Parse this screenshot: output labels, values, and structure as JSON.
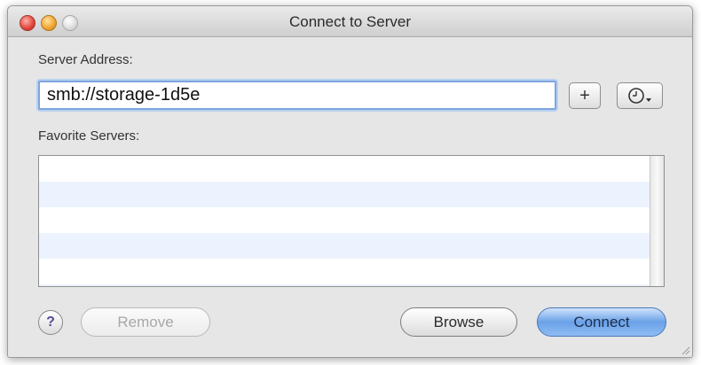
{
  "window": {
    "title": "Connect to Server"
  },
  "server_address": {
    "label": "Server Address:",
    "value": "smb://storage-1d5e"
  },
  "buttons": {
    "add_label": "+",
    "recent_icon": "clock-dropdown-icon",
    "help_label": "?",
    "remove_label": "Remove",
    "browse_label": "Browse",
    "connect_label": "Connect"
  },
  "favorites": {
    "label": "Favorite Servers:",
    "items": []
  },
  "colors": {
    "focus_ring": "#7ea6de",
    "default_button": "#6aa1e8",
    "row_alt": "#edf3fe"
  }
}
